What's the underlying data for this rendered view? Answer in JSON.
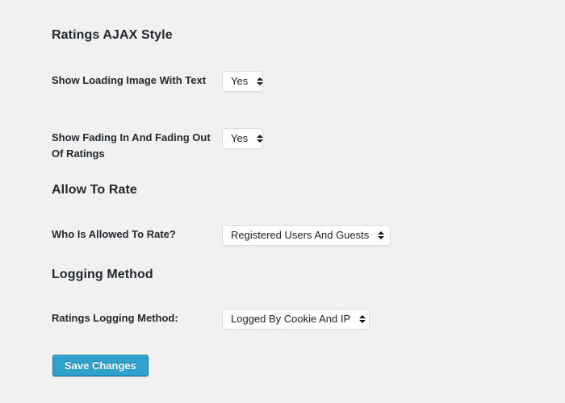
{
  "page": {
    "background_color": "#f1f1f1",
    "text_color": "#23282d",
    "accent_color": "#2ea2cc"
  },
  "sections": [
    {
      "heading": "Ratings AJAX Style",
      "fields": [
        {
          "label": "Show Loading Image With Text",
          "control": "select",
          "value": "Yes"
        },
        {
          "label": "Show Fading In And Fading Out Of Ratings",
          "control": "select",
          "value": "Yes"
        }
      ]
    },
    {
      "heading": "Allow To Rate",
      "fields": [
        {
          "label": "Who Is Allowed To Rate?",
          "control": "select",
          "value": "Registered Users And Guests"
        }
      ]
    },
    {
      "heading": "Logging Method",
      "fields": [
        {
          "label": "Ratings Logging Method:",
          "control": "select",
          "value": "Logged By Cookie And IP"
        }
      ]
    }
  ],
  "actions": {
    "save_label": "Save Changes"
  },
  "icons": {
    "select_arrows": "up-down-arrows-icon"
  }
}
